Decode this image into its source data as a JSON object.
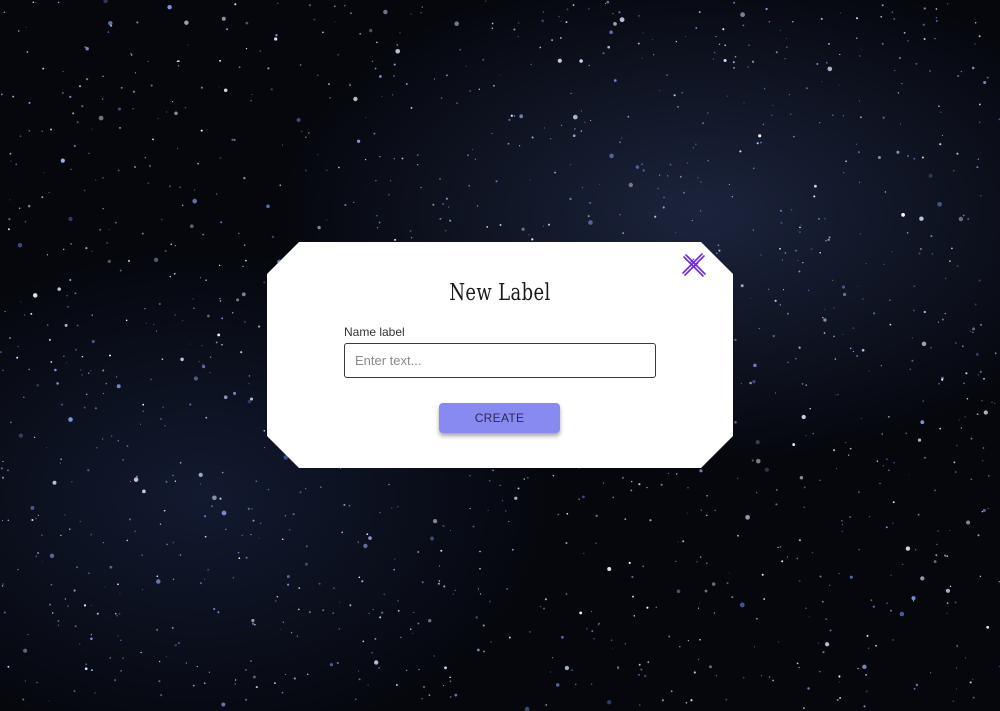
{
  "modal": {
    "title": "New Label",
    "field_label": "Name label",
    "input_value": "",
    "input_placeholder": "Enter text...",
    "create_label": "CREATE",
    "close_icon": "close-icon"
  },
  "colors": {
    "accent": "#8989f2",
    "close_icon": "#6b2fd6",
    "modal_bg": "#ffffff",
    "page_bg": "#05070d"
  }
}
